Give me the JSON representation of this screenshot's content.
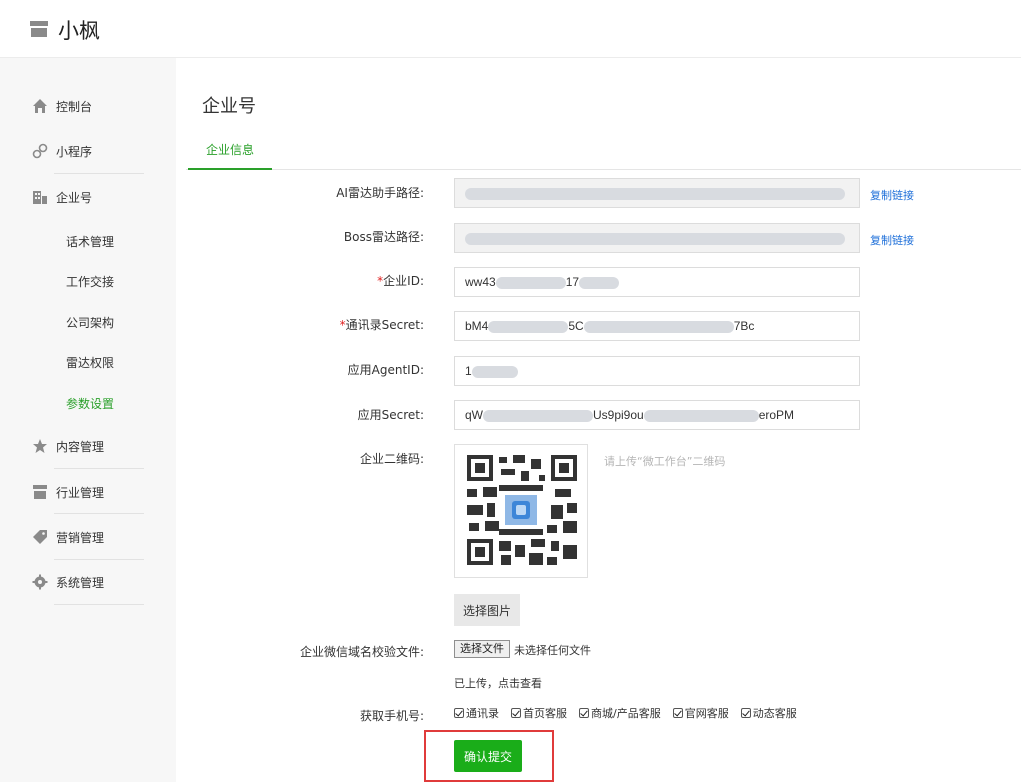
{
  "brand": {
    "name": "小枫",
    "icon": "store-icon"
  },
  "sidebar": {
    "items": [
      {
        "label": "控制台",
        "icon": "home-icon"
      },
      {
        "label": "小程序",
        "icon": "miniprogram-icon"
      },
      {
        "label": "企业号",
        "icon": "building-icon"
      },
      {
        "label": "内容管理",
        "icon": "star-icon"
      },
      {
        "label": "行业管理",
        "icon": "store-icon"
      },
      {
        "label": "营销管理",
        "icon": "tag-icon"
      },
      {
        "label": "系统管理",
        "icon": "gear-icon"
      }
    ],
    "subitems": [
      {
        "label": "话术管理"
      },
      {
        "label": "工作交接"
      },
      {
        "label": "公司架构"
      },
      {
        "label": "雷达权限"
      },
      {
        "label": "参数设置",
        "active": true
      }
    ]
  },
  "page": {
    "title": "企业号",
    "tab": "企业信息"
  },
  "form": {
    "ai_radar": {
      "label": "AI雷达助手路径:",
      "copy": "复制链接"
    },
    "boss_radar": {
      "label": "Boss雷达路径:",
      "copy": "复制链接"
    },
    "corp_id": {
      "req": "*",
      "label": "企业ID:",
      "value": "ww43",
      "value_end": "17"
    },
    "contacts_secret": {
      "req": "*",
      "label": "通讯录Secret:",
      "value": "bM4",
      "value_mid": "5C",
      "value_end": "7Bc"
    },
    "agent_id": {
      "label": "应用AgentID:",
      "value": "1"
    },
    "app_secret": {
      "label": "应用Secret:",
      "value": "qW",
      "value_mid": "Us9pi9ou",
      "value_end": "eroPM"
    },
    "qrcode": {
      "label": "企业二维码:",
      "hint": "请上传“微工作台”二维码",
      "choose": "选择图片"
    },
    "domain_file": {
      "label": "企业微信域名校验文件:",
      "button": "选择文件",
      "none": "未选择任何文件",
      "uploaded": "已上传，点击查看"
    },
    "phone": {
      "label": "获取手机号:",
      "options": [
        "通讯录",
        "首页客服",
        "商城/产品客服",
        "官网客服",
        "动态客服"
      ]
    },
    "submit": "确认提交"
  },
  "colors": {
    "accent": "#1aad19",
    "link": "#1e6fd9",
    "highlight": "#e03b3b"
  }
}
